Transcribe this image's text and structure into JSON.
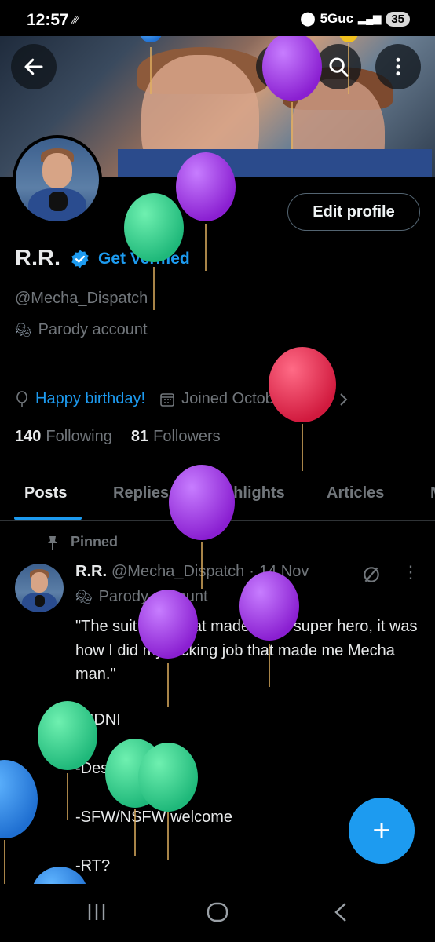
{
  "status_bar": {
    "time": "12:57",
    "network": "5Guc",
    "battery": "35"
  },
  "header": {
    "back_icon": "arrow-left-icon",
    "grok_icon": "grok-icon",
    "search_icon": "search-icon",
    "more_icon": "more-vertical-icon"
  },
  "profile": {
    "edit_label": "Edit profile",
    "name": "R.R.",
    "get_verified": "Get Verified",
    "handle": "@Mecha_Dispatch",
    "parody_label": "Parody account",
    "birthday": "Happy birthday!",
    "joined": "Joined October 2025",
    "following_count": "140",
    "following_label": "Following",
    "followers_count": "81",
    "followers_label": "Followers"
  },
  "tabs": [
    {
      "label": "Posts"
    },
    {
      "label": "Replies"
    },
    {
      "label": "Highlights"
    },
    {
      "label": "Articles"
    }
  ],
  "post": {
    "pinned_label": "Pinned",
    "author_name": "R.R.",
    "author_handle": "@Mecha_Dispatch",
    "separator": "·",
    "date": "14 Nov",
    "parody_label": "Parody account",
    "text": "\"The suit isn't what made me a super hero, it was how I did my fucking job that made me Mecha man.\"",
    "line1": "-MDNI",
    "line2": "-Descriptive",
    "line3": "-SFW/NSFW welcome",
    "line4": "-RT?"
  },
  "fab_label": "+",
  "colors": {
    "accent": "#1d9bf0",
    "background": "#000000",
    "text_primary": "#e7e9ea",
    "text_secondary": "#71767b"
  }
}
